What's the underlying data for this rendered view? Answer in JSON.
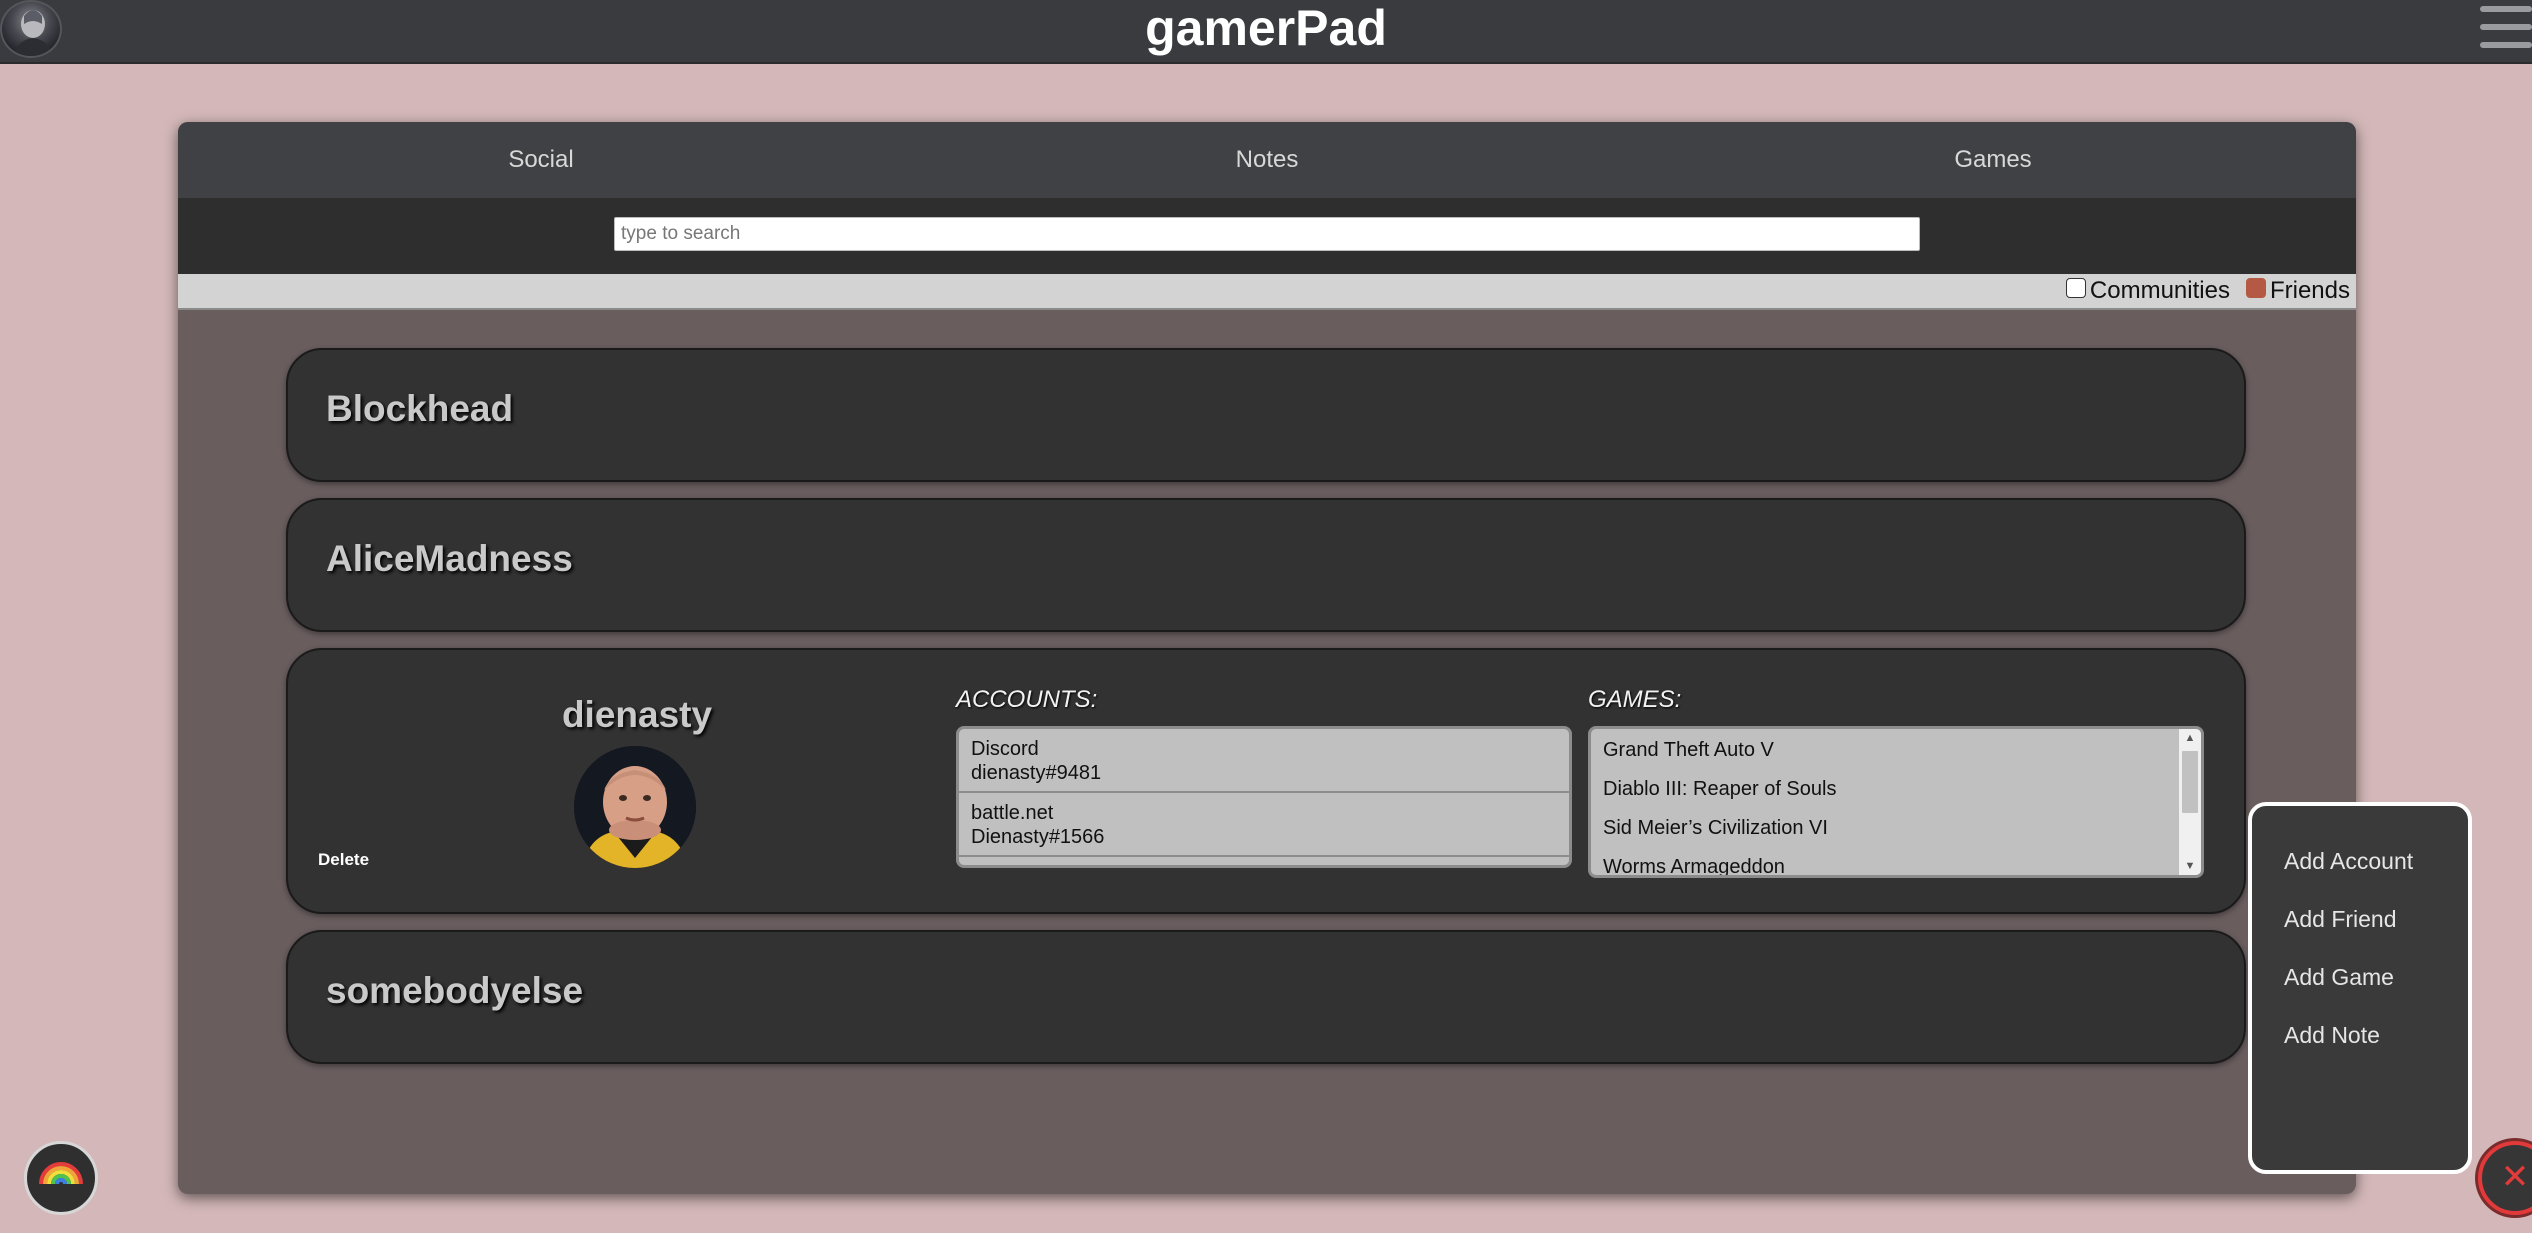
{
  "app": {
    "title": "gamerPad"
  },
  "tabs": [
    {
      "label": "Social"
    },
    {
      "label": "Notes"
    },
    {
      "label": "Games"
    }
  ],
  "search": {
    "placeholder": "type to search",
    "value": ""
  },
  "filters": [
    {
      "label": "Communities",
      "checked": false
    },
    {
      "label": "Friends",
      "checked": true
    }
  ],
  "cards": [
    {
      "name": "Blockhead"
    },
    {
      "name": "AliceMadness"
    },
    {
      "name": "dienasty",
      "delete_label": "Delete",
      "accounts_heading": "ACCOUNTS:",
      "games_heading": "GAMES:",
      "accounts": [
        {
          "service": "Discord",
          "handle": "dienasty#9481"
        },
        {
          "service": "battle.net",
          "handle": "Dienasty#1566"
        }
      ],
      "games": [
        "Grand Theft Auto V",
        "Diablo III: Reaper of Souls",
        "Sid Meier’s Civilization VI",
        "Worms Armageddon"
      ]
    },
    {
      "name": "somebodyelse"
    }
  ],
  "popup_menu": {
    "items": [
      {
        "label": "Add Account"
      },
      {
        "label": "Add Friend"
      },
      {
        "label": "Add Game"
      },
      {
        "label": "Add Note"
      }
    ]
  },
  "fabs": {
    "close_symbol": "✕",
    "close_icon": "close-icon",
    "theme_icon": "rainbow-icon"
  },
  "colors": {
    "background": "#d4b8b9",
    "header": "#393b3e",
    "panel": "#695d5e",
    "card": "#323232",
    "accent_red": "#e23a3a",
    "friends_checkbox": "#b45a44"
  }
}
